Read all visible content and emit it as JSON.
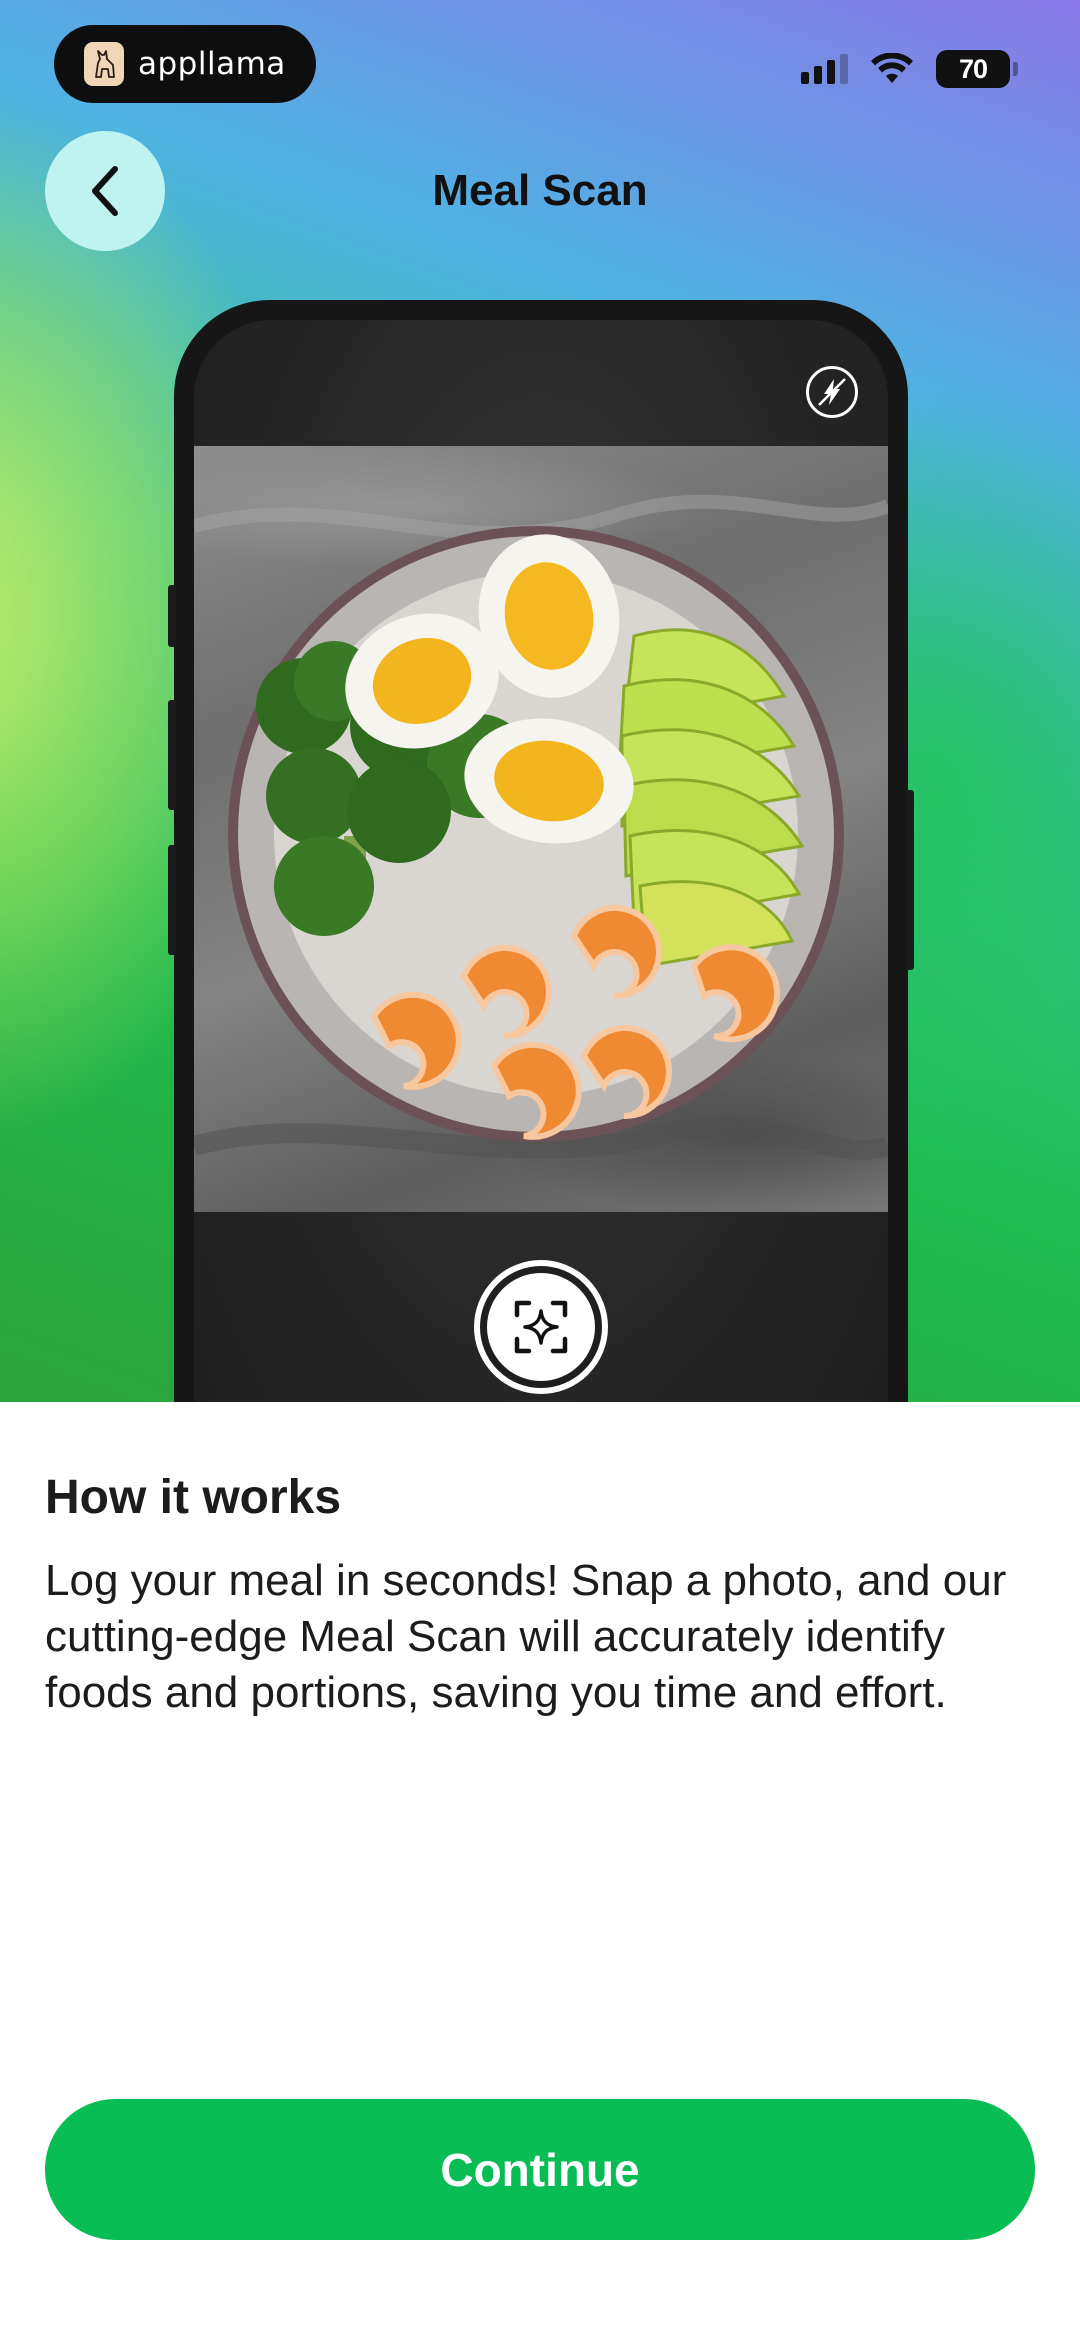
{
  "status_bar": {
    "brand_name": "appllama",
    "battery": "70"
  },
  "header": {
    "title": "Meal Scan"
  },
  "content": {
    "heading": "How it works",
    "body": "Log your meal in seconds! Snap a photo, and our cutting-edge Meal Scan will accurately identify foods and portions, saving you time and effort."
  },
  "footer": {
    "continue_label": "Continue"
  },
  "icons": {
    "back": "chevron-left-icon",
    "flash": "flash-off-icon",
    "scan": "sparkle-scan-icon"
  },
  "colors": {
    "primary_green": "#08bd54",
    "back_button": "#bff3ef"
  }
}
